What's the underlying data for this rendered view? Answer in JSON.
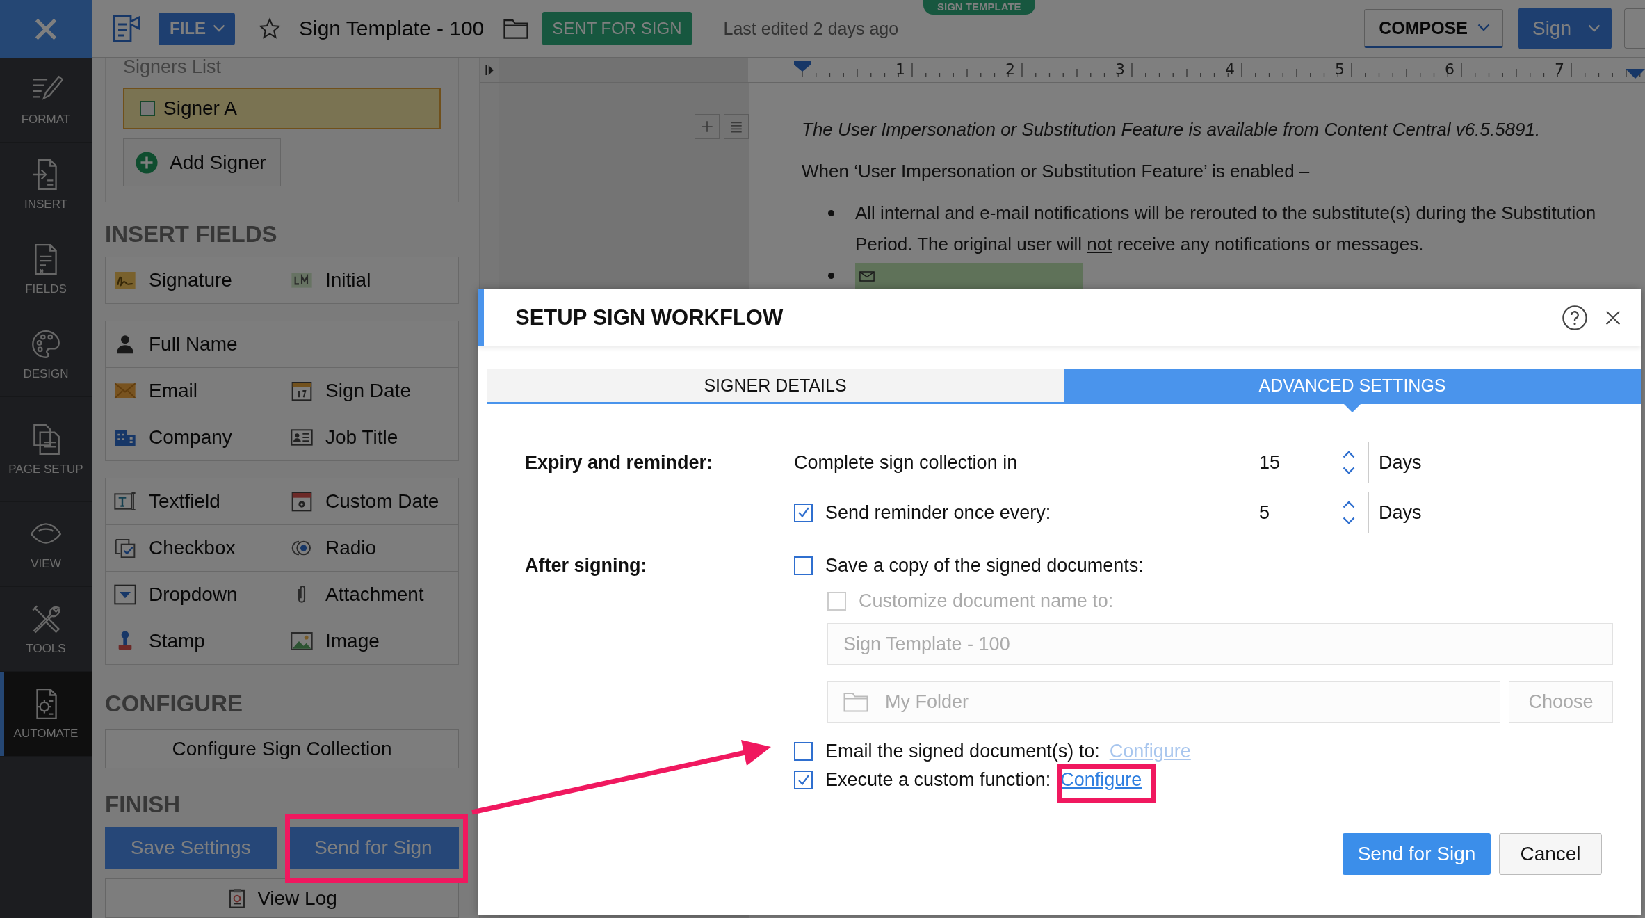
{
  "topbar": {
    "file_menu": "FILE",
    "title": "Sign Template - 100",
    "status": "SENT FOR SIGN",
    "last_edited": "Last edited 2 days ago",
    "template_badge": "SIGN TEMPLATE",
    "compose": "COMPOSE",
    "sign": "Sign"
  },
  "rail": [
    {
      "label": "FORMAT",
      "kind": "format",
      "selected": false
    },
    {
      "label": "INSERT",
      "kind": "insert",
      "selected": false
    },
    {
      "label": "FIELDS",
      "kind": "fields",
      "selected": false
    },
    {
      "label": "DESIGN",
      "kind": "design",
      "selected": false
    },
    {
      "label": "PAGE SETUP",
      "kind": "page",
      "selected": false
    },
    {
      "label": "VIEW",
      "kind": "view",
      "selected": false
    },
    {
      "label": "TOOLS",
      "kind": "tools",
      "selected": false
    },
    {
      "label": "AUTOMATE",
      "kind": "automate",
      "selected": true
    }
  ],
  "panel": {
    "signers_title": "Signers List",
    "signers": [
      {
        "name": "Signer A"
      }
    ],
    "add_signer": "Add Signer",
    "insert_title": "INSERT FIELDS",
    "field_groups": [
      [
        [
          {
            "label": "Signature",
            "kind": "signature"
          },
          {
            "label": "Initial",
            "kind": "initial"
          }
        ]
      ],
      [
        [
          {
            "label": "Full Name",
            "kind": "person"
          }
        ],
        [
          {
            "label": "Email",
            "kind": "email"
          },
          {
            "label": "Sign Date",
            "kind": "date"
          }
        ],
        [
          {
            "label": "Company",
            "kind": "company"
          },
          {
            "label": "Job Title",
            "kind": "job"
          }
        ]
      ],
      [
        [
          {
            "label": "Textfield",
            "kind": "textfield"
          },
          {
            "label": "Custom Date",
            "kind": "customdate"
          }
        ],
        [
          {
            "label": "Checkbox",
            "kind": "checkbox"
          },
          {
            "label": "Radio",
            "kind": "radio"
          }
        ],
        [
          {
            "label": "Dropdown",
            "kind": "dropdown"
          },
          {
            "label": "Attachment",
            "kind": "attachment"
          }
        ],
        [
          {
            "label": "Stamp",
            "kind": "stamp"
          },
          {
            "label": "Image",
            "kind": "image"
          }
        ]
      ]
    ],
    "configure_title": "CONFIGURE",
    "configure_button": "Configure Sign Collection",
    "finish_title": "FINISH",
    "save_button": "Save Settings",
    "send_button": "Send for Sign",
    "view_log": "View Log"
  },
  "ruler": {
    "numbers": [
      "1",
      "2",
      "3",
      "4",
      "5",
      "6",
      "7"
    ]
  },
  "document": [
    {
      "kind": "note",
      "parts": [
        {
          "text": "The User Impersonation or Substitution Feature is available from Content Central v6.5.5891.",
          "underline": false
        }
      ]
    },
    {
      "kind": "paragraph",
      "parts": [
        {
          "text": "When ‘User Impersonation or Substitution Feature’ is enabled –",
          "underline": false
        }
      ]
    },
    {
      "kind": "bullet",
      "parts": [
        {
          "text": "All internal and e-mail notifications will be rerouted to the substitute(s) during the Substitution Period. The original user will ",
          "underline": false
        },
        {
          "text": "not",
          "underline": true
        },
        {
          "text": " receive any notifications or messages.",
          "underline": false
        }
      ]
    },
    {
      "kind": "field-bullet"
    }
  ],
  "dialog": {
    "title": "SETUP SIGN WORKFLOW",
    "tabs": [
      {
        "label": "SIGNER DETAILS",
        "selected": false
      },
      {
        "label": "ADVANCED SETTINGS",
        "selected": true
      }
    ],
    "expiry_label": "Expiry and reminder:",
    "collection": {
      "label": "Complete sign collection in",
      "value": "15",
      "unit": "Days"
    },
    "reminder": {
      "label": "Send reminder once every:",
      "checked": true,
      "value": "5",
      "unit": "Days"
    },
    "after_label": "After signing:",
    "save_copy": {
      "label": "Save a copy of the signed documents:",
      "checked": false
    },
    "customize_name": {
      "label": "Customize document name to:",
      "checked": false,
      "disabled": true
    },
    "name_field": {
      "value": "Sign Template - 100",
      "disabled": true
    },
    "folder_field": {
      "value": "My Folder",
      "disabled": true
    },
    "choose_button": {
      "label": "Choose",
      "disabled": true
    },
    "actions": [
      {
        "label": "Email the signed document(s) to:",
        "checked": false,
        "link": "Configure"
      },
      {
        "label": "Execute a custom function:",
        "checked": true,
        "link": "Configure"
      }
    ],
    "buttons": [
      {
        "label": "Send for Sign",
        "kind": "primary"
      },
      {
        "label": "Cancel",
        "kind": "secondary"
      }
    ]
  }
}
